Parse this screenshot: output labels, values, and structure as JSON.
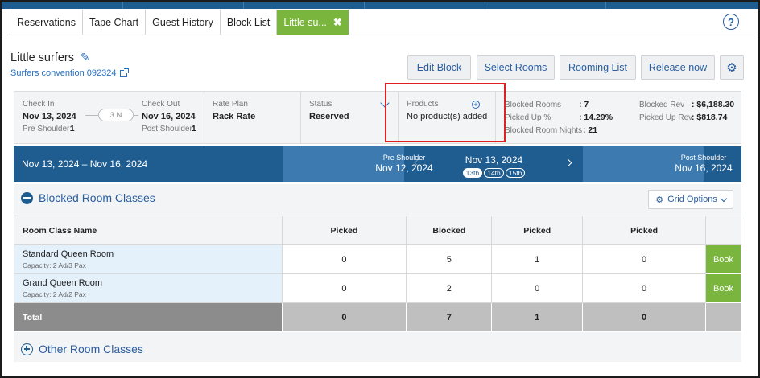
{
  "tabs": [
    {
      "label": "Reservations"
    },
    {
      "label": "Tape Chart"
    },
    {
      "label": "Guest History"
    },
    {
      "label": "Block List"
    },
    {
      "label": "Little su...",
      "active": true
    }
  ],
  "help_label": "?",
  "block": {
    "name": "Little surfers",
    "link": "Surfers convention 092324"
  },
  "actions": {
    "edit": "Edit Block",
    "select_rooms": "Select Rooms",
    "rooming_list": "Rooming List",
    "release": "Release now"
  },
  "summary": {
    "checkin_label": "Check In",
    "checkin": "Nov 13, 2024",
    "pre_shoulder_label": "Pre Shoulder:",
    "pre_shoulder": "1",
    "nights": "3 N",
    "checkout_label": "Check Out",
    "checkout": "Nov 16, 2024",
    "post_shoulder_label": "Post Shoulder:",
    "post_shoulder": "1",
    "rate_plan_label": "Rate Plan",
    "rate_plan": "Rack Rate",
    "status_label": "Status",
    "status": "Reserved",
    "products_label": "Products",
    "products": "No product(s) added",
    "blocked_rooms_label": "Blocked Rooms",
    "blocked_rooms": ": 7",
    "picked_up_pct_label": "Picked Up %",
    "picked_up_pct": ": 14.29%",
    "blocked_nights_label": "Blocked Room Nights",
    "blocked_nights": ": 21",
    "blocked_rev_label": "Blocked Rev",
    "blocked_rev": ": $6,188.30",
    "picked_rev_label": "Picked Up Rev",
    "picked_rev": ": $818.74"
  },
  "datebar": {
    "range": "Nov 13, 2024 – Nov 16, 2024",
    "pre_label": "Pre Shoulder",
    "pre_date": "Nov 12, 2024",
    "current": "Nov 13, 2024",
    "days": [
      "13th",
      "14th",
      "15th"
    ],
    "post_label": "Post Shoulder",
    "post_date": "Nov 16, 2024"
  },
  "section": {
    "title": "Blocked Room Classes",
    "grid_options": "Grid Options",
    "other": "Other Room Classes"
  },
  "grid": {
    "headers": [
      "Room Class Name",
      "Picked",
      "Blocked",
      "Picked",
      "Picked"
    ],
    "rows": [
      {
        "name": "Standard Queen Room",
        "cap": "Capacity: 2 Ad/3 Pax",
        "c1": "0",
        "c2": "5",
        "c3": "1",
        "c4": "0",
        "book": "Book"
      },
      {
        "name": "Grand Queen Room",
        "cap": "Capacity: 2 Ad/2 Pax",
        "c1": "0",
        "c2": "2",
        "c3": "0",
        "c4": "0",
        "book": "Book"
      }
    ],
    "total": {
      "name": "Total",
      "c1": "0",
      "c2": "7",
      "c3": "1",
      "c4": "0"
    }
  }
}
